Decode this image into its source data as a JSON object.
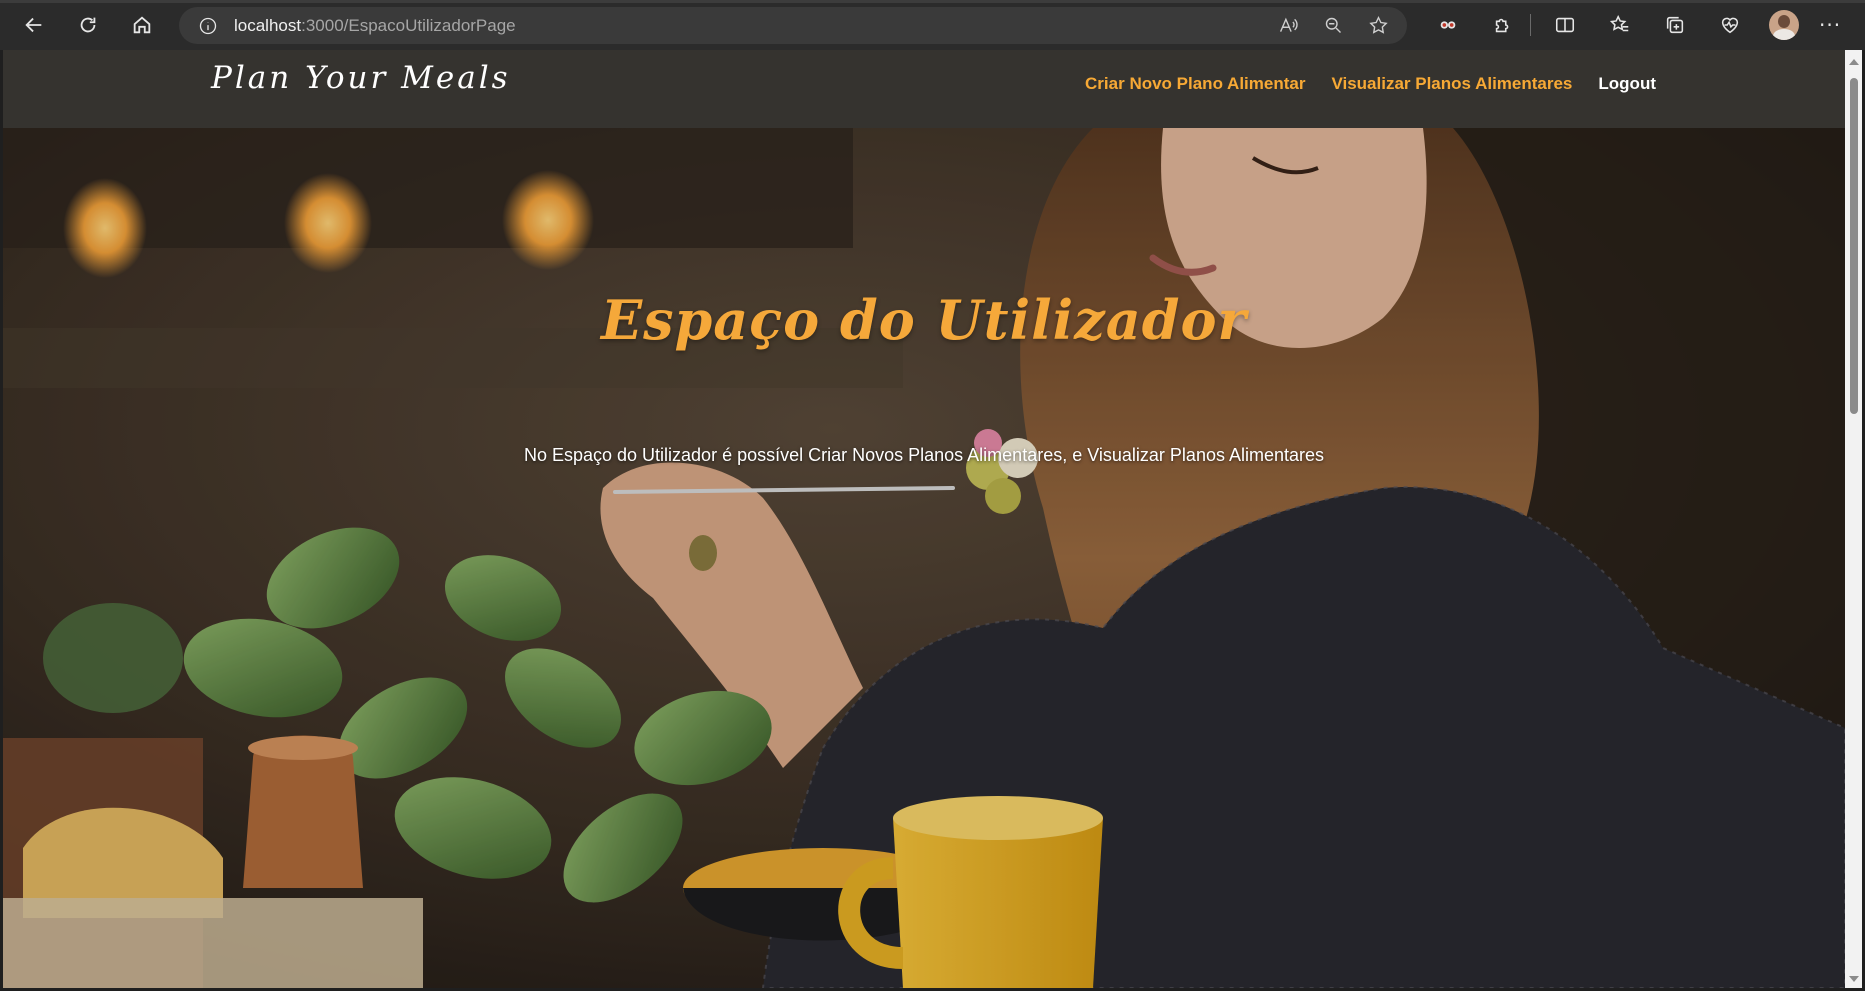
{
  "browser": {
    "url_host": "localhost",
    "url_path": ":3000/EspacoUtilizadorPage",
    "icons": [
      "back-icon",
      "refresh-icon",
      "home-icon",
      "info-icon",
      "read-aloud-icon",
      "zoom-icon",
      "favorite-star-icon",
      "extension-icon",
      "puzzle-icon",
      "split-screen-icon",
      "favorites-icon",
      "collections-icon",
      "performance-icon",
      "profile-avatar",
      "more-icon"
    ]
  },
  "navbar": {
    "brand": "Plan Your Meals",
    "links": [
      {
        "label": "Criar Novo Plano Alimentar"
      },
      {
        "label": "Visualizar Planos Alimentares"
      },
      {
        "label": "Logout"
      }
    ],
    "link_color": "#f7a935",
    "background": "#35332f"
  },
  "hero": {
    "title": "Espaço do Utilizador",
    "subtitle": "No Espaço do Utilizador é possível Criar Novos Planos Alimentares, e Visualizar Planos Alimentares",
    "title_color": "#f5a83a"
  }
}
